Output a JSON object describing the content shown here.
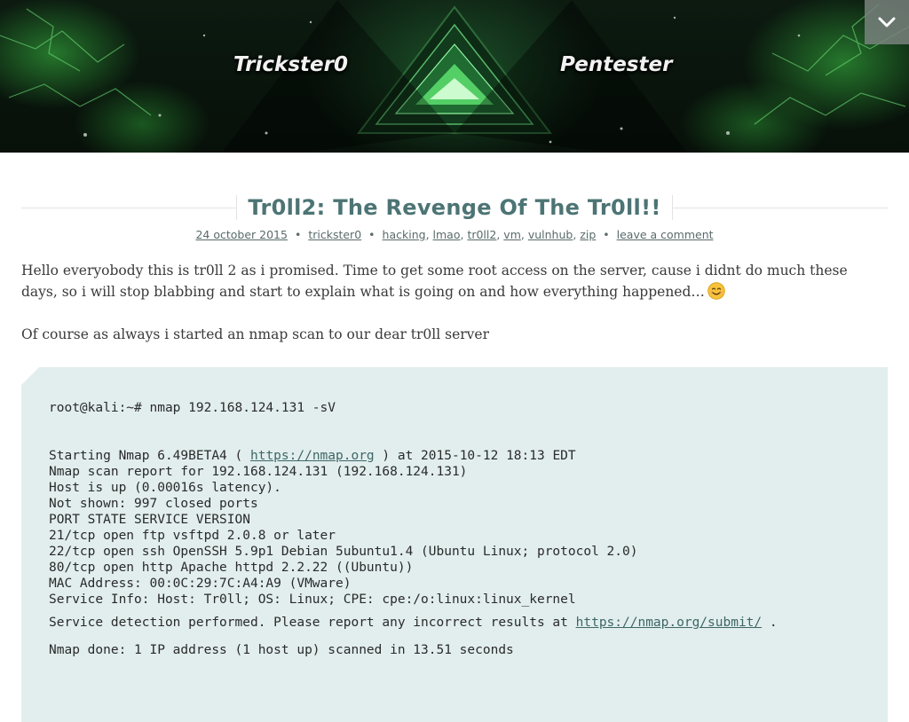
{
  "header": {
    "left_text": "Trickster0",
    "right_text": "Pentester",
    "menu_icon": "chevron-down-icon"
  },
  "post": {
    "title": "Tr0ll2: The Revenge Of The Tr0ll!!",
    "date": "24 october 2015",
    "author": "trickster0",
    "tags": [
      "hacking",
      "lmao",
      "tr0ll2",
      "vm",
      "vulnhub",
      "zip"
    ],
    "comment_link": "leave a comment",
    "paragraph1": "Hello everyobody this is tr0ll 2 as i promised. Time to get some root access on the server, cause i didnt do much these days, so i will stop blabbing and start to explain what is going on and how everything happened…",
    "paragraph2": "Of course as always i started an nmap scan to our dear tr0ll server"
  },
  "code": {
    "command": "root@kali:~# nmap 192.168.124.131 -sV",
    "start_prefix": "Starting Nmap 6.49BETA4 ( ",
    "start_link": "https://nmap.org",
    "start_suffix": " ) at 2015-10-12 18:13 EDT",
    "lines": [
      "Nmap scan report for 192.168.124.131 (192.168.124.131)",
      "Host is up (0.00016s latency).",
      "Not shown: 997 closed ports",
      "PORT STATE SERVICE VERSION",
      "21/tcp open ftp vsftpd 2.0.8 or later",
      "22/tcp open ssh OpenSSH 5.9p1 Debian 5ubuntu1.4 (Ubuntu Linux; protocol 2.0)",
      "80/tcp open http Apache httpd 2.2.22 ((Ubuntu))",
      "MAC Address: 00:0C:29:7C:A4:A9 (VMware)",
      "Service Info: Host: Tr0ll; OS: Linux; CPE: cpe:/o:linux:linux_kernel"
    ],
    "detect_prefix": "Service detection performed. Please report any incorrect results at ",
    "detect_link": "https://nmap.org/submit/",
    "detect_suffix": " .",
    "done": "Nmap done: 1 IP address (1 host up) scanned in 13.51 seconds"
  },
  "colors": {
    "title": "#4d7474",
    "code_bg": "#e2eeee",
    "banner_glow": "#3cc846"
  }
}
